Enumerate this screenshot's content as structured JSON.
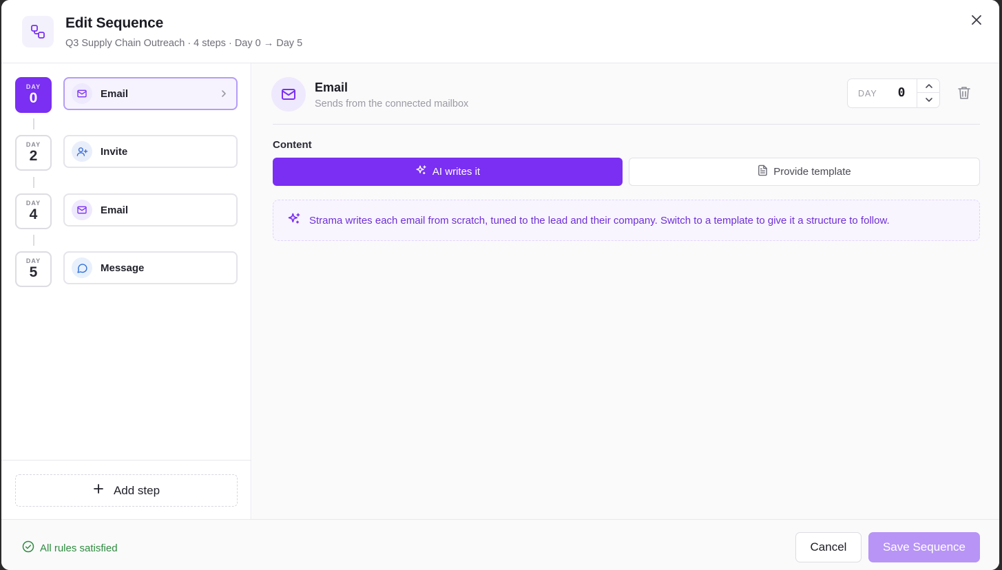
{
  "header": {
    "title": "Edit Sequence",
    "subtitle": "Q3 Supply Chain Outreach · 4 steps · Day 0 → Day 5",
    "icon": "workflow-icon",
    "close_icon": "close-icon"
  },
  "steps": [
    {
      "day_label": "DAY",
      "day": "0",
      "label": "Email",
      "icon": "mail-icon",
      "active": true
    },
    {
      "day_label": "DAY",
      "day": "2",
      "label": "Invite",
      "icon": "user-plus-icon",
      "active": false
    },
    {
      "day_label": "DAY",
      "day": "4",
      "label": "Email",
      "icon": "mail-icon",
      "active": false
    },
    {
      "day_label": "DAY",
      "day": "5",
      "label": "Message",
      "icon": "chat-icon",
      "active": false
    }
  ],
  "add_step": {
    "label": "Add step",
    "icon": "plus-icon"
  },
  "detail": {
    "channel_title": "Email",
    "channel_sub": "Sends from the connected mailbox",
    "day_label": "DAY",
    "day_value": "0",
    "content_label": "Content",
    "ai_option": "AI writes it",
    "template_option": "Provide template",
    "note": "Strama writes each email from scratch, tuned to the lead and their company. Switch to a template to give it a structure to follow."
  },
  "footer": {
    "rules_status": "All rules satisfied",
    "cancel_label": "Cancel",
    "save_label": "Save Sequence"
  },
  "colors": {
    "accent": "#7a2ff2",
    "accent_disabled": "#b794f6",
    "success": "#2e8b3e"
  }
}
